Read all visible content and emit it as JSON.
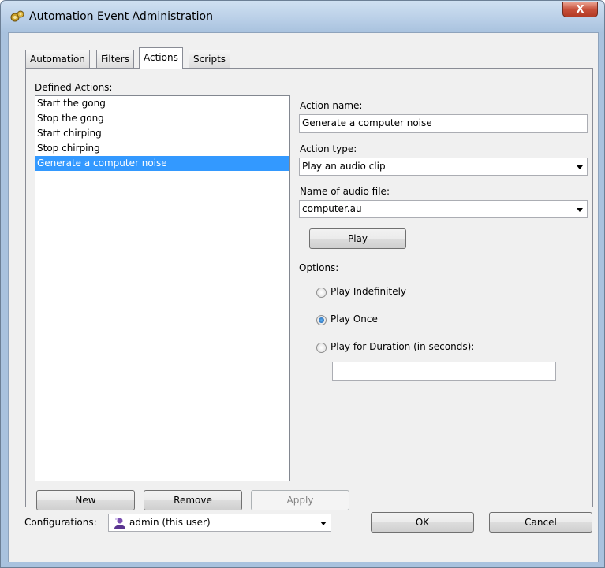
{
  "window": {
    "title": "Automation Event Administration",
    "close_glyph": "X"
  },
  "tabs": [
    {
      "label": "Automation",
      "active": false
    },
    {
      "label": "Filters",
      "active": false
    },
    {
      "label": "Actions",
      "active": true
    },
    {
      "label": "Scripts",
      "active": false
    }
  ],
  "actions_panel": {
    "defined_actions_label": "Defined Actions:",
    "items": [
      {
        "label": "Start the gong",
        "selected": false
      },
      {
        "label": "Stop the gong",
        "selected": false
      },
      {
        "label": "Start chirping",
        "selected": false
      },
      {
        "label": "Stop chirping",
        "selected": false
      },
      {
        "label": "Generate a computer noise",
        "selected": true
      }
    ],
    "action_name_label": "Action name:",
    "action_name_value": "Generate a computer noise",
    "action_type_label": "Action type:",
    "action_type_value": "Play an audio clip",
    "audio_file_label": "Name of audio file:",
    "audio_file_value": "computer.au",
    "play_button": "Play",
    "options_label": "Options:",
    "options": [
      {
        "label": "Play Indefinitely",
        "checked": false
      },
      {
        "label": "Play Once",
        "checked": true
      },
      {
        "label": "Play for Duration (in seconds):",
        "checked": false
      }
    ],
    "duration_value": "",
    "new_button": "New",
    "remove_button": "Remove",
    "apply_button": "Apply"
  },
  "footer": {
    "configurations_label": "Configurations:",
    "configuration_value": "admin (this user)",
    "ok_button": "OK",
    "cancel_button": "Cancel"
  },
  "icons": {
    "app": "gears-icon",
    "user": "user-icon",
    "dropdown": "chevron-down-icon",
    "close": "close-icon"
  }
}
